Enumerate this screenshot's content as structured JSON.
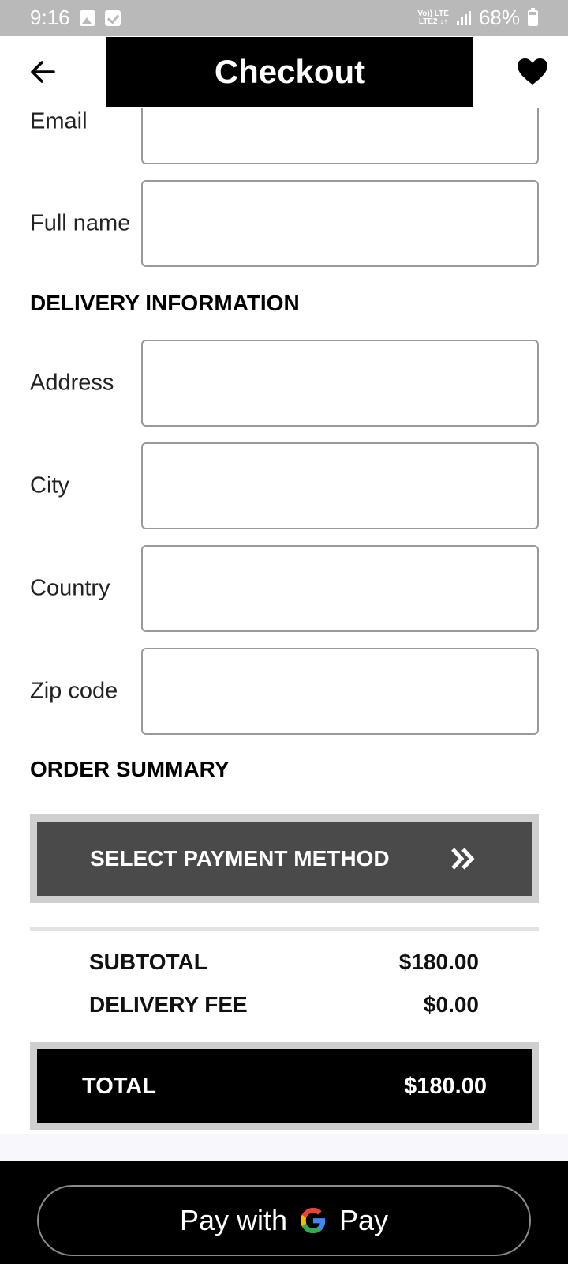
{
  "status_bar": {
    "time": "9:16",
    "network_top": "Vo)) LTE",
    "network_bottom": "LTE2 ↓↑",
    "battery": "68%"
  },
  "header": {
    "title": "Checkout",
    "back_icon": "arrow-left-icon",
    "favorite_icon": "heart-icon"
  },
  "contact": {
    "email_label": "Email",
    "email_value": "",
    "fullname_label": "Full name",
    "fullname_value": ""
  },
  "delivery": {
    "section_title": "DELIVERY INFORMATION",
    "address_label": "Address",
    "city_label": "City",
    "country_label": "Country",
    "zip_label": "Zip code"
  },
  "order_summary": {
    "section_title": "ORDER SUMMARY",
    "select_payment_label": "SELECT PAYMENT METHOD",
    "select_payment_icon": "double-chevron-right-icon",
    "subtotal_label": "SUBTOTAL",
    "subtotal_value": "$180.00",
    "delivery_fee_label": "DELIVERY FEE",
    "delivery_fee_value": "$0.00",
    "total_label": "TOTAL",
    "total_value": "$180.00"
  },
  "gpay": {
    "prefix": "Pay with",
    "suffix": "Pay",
    "logo_icon": "google-g-icon"
  },
  "colors": {
    "status_bar": "#b9b9b9",
    "primary_black": "#000000",
    "payment_button": "#4a4a4a",
    "frame_gray": "#cfcfcf",
    "field_border": "#9a9a9a"
  }
}
